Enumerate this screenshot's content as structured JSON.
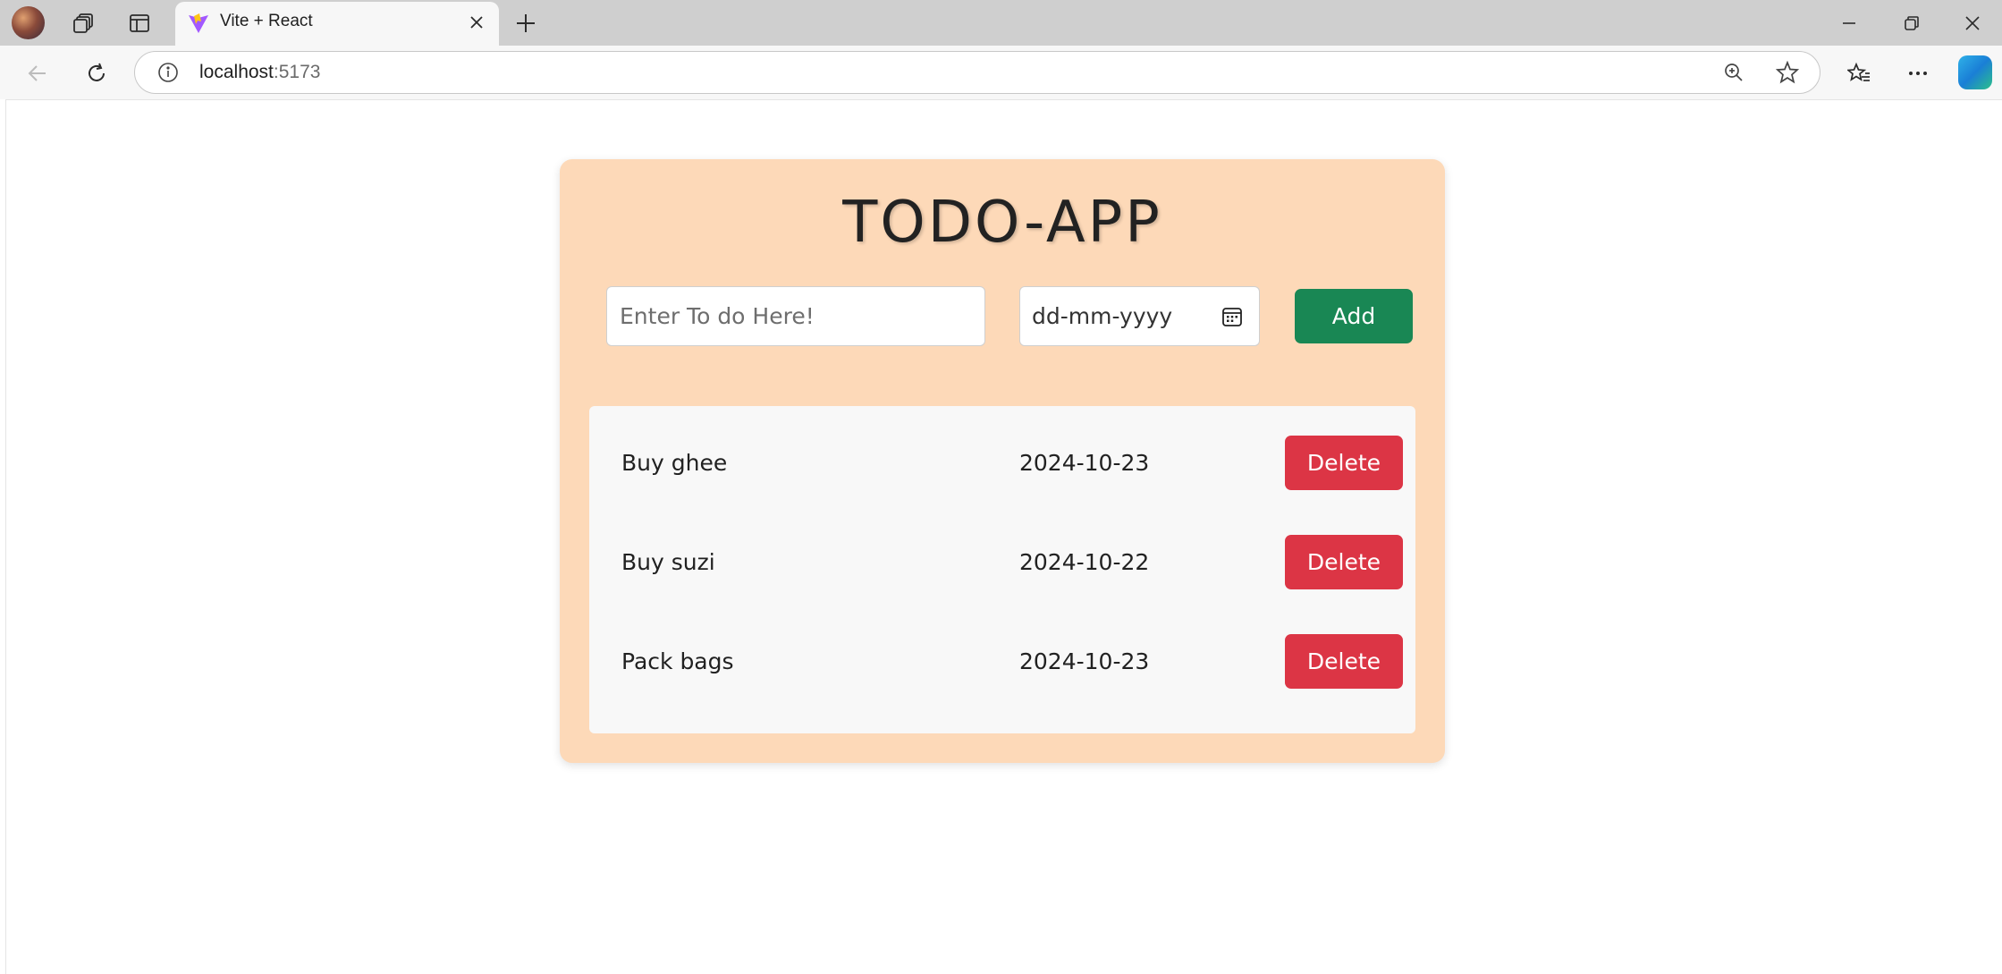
{
  "browser": {
    "tab_title": "Vite + React",
    "address_host": "localhost",
    "address_port": ":5173"
  },
  "app": {
    "title": "TODO-APP",
    "todo_placeholder": "Enter To do Here!",
    "date_placeholder": "dd-mm-yyyy",
    "add_label": "Add",
    "delete_label": "Delete",
    "items": [
      {
        "name": "Buy ghee",
        "date": "2024-10-23"
      },
      {
        "name": "Buy suzi",
        "date": "2024-10-22"
      },
      {
        "name": "Pack bags",
        "date": "2024-10-23"
      }
    ]
  },
  "colors": {
    "card_bg": "#fdd9b8",
    "add_button": "#198754",
    "delete_button": "#dc3545",
    "list_bg": "#f8f8f8"
  },
  "icons": [
    "profile-avatar",
    "workspaces-icon",
    "vertical-tabs-icon",
    "vite-favicon",
    "close-icon",
    "plus-icon",
    "minimize-icon",
    "restore-icon",
    "window-close-icon",
    "back-icon",
    "refresh-icon",
    "info-icon",
    "zoom-icon",
    "star-icon",
    "favorites-icon",
    "more-icon",
    "copilot-icon",
    "calendar-icon"
  ]
}
